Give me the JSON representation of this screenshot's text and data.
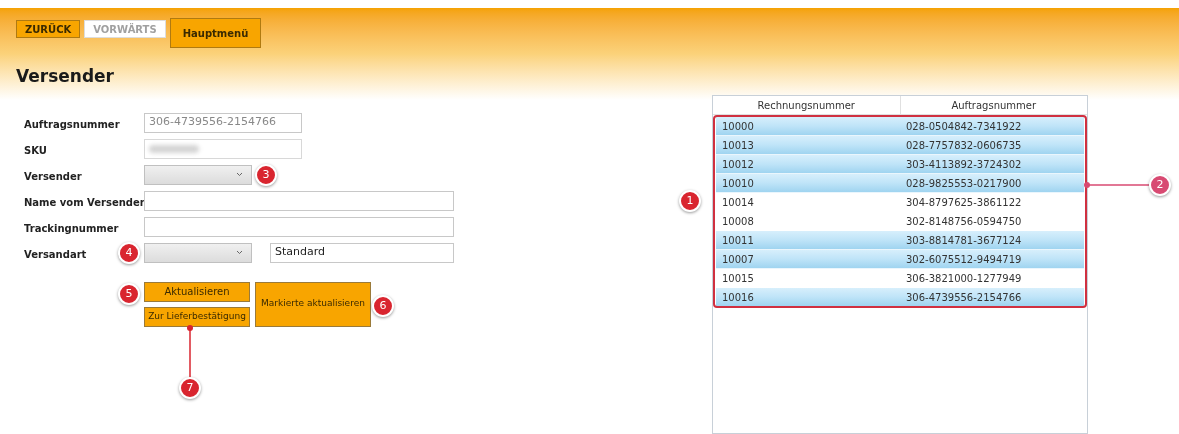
{
  "nav_buttons": [
    {
      "label": "ZURÜCK",
      "disabled": false,
      "selected": false
    },
    {
      "label": "VORWÄRTS",
      "disabled": true,
      "selected": false
    },
    {
      "label": "Hauptmenü",
      "disabled": false,
      "selected": true
    }
  ],
  "title": "Versender",
  "form": [
    {
      "kind": "text",
      "label": "Auftragsnummer",
      "value": "306-4739556-2154766",
      "readonly": true
    },
    {
      "kind": "blurred",
      "label": "SKU"
    },
    {
      "kind": "combo",
      "label": "Versender"
    },
    {
      "kind": "wide_text",
      "label": "Name vom Versender"
    },
    {
      "kind": "wide_text",
      "label": "Trackingnummer"
    },
    {
      "kind": "combo_text",
      "label": "Versandart",
      "value": "Standard"
    }
  ],
  "actions": {
    "update": "Aktualisieren",
    "confirm": "Zur Lieferbestätigung",
    "update_marked": "Markierte aktualisieren"
  },
  "table": {
    "columns": [
      "Rechnungsnummer",
      "Auftragsnummer"
    ],
    "rows": [
      {
        "cells": [
          "10000",
          "028-0504842-7341922"
        ],
        "selected": true
      },
      {
        "cells": [
          "10013",
          "028-7757832-0606735"
        ],
        "selected": true
      },
      {
        "cells": [
          "10012",
          "303-4113892-3724302"
        ],
        "selected": true
      },
      {
        "cells": [
          "10010",
          "028-9825553-0217900"
        ],
        "selected": true
      },
      {
        "cells": [
          "10014",
          "304-8797625-3861122"
        ],
        "selected": false
      },
      {
        "cells": [
          "10008",
          "302-8148756-0594750"
        ],
        "selected": false
      },
      {
        "cells": [
          "10011",
          "303-8814781-3677124"
        ],
        "selected": true
      },
      {
        "cells": [
          "10007",
          "302-6075512-9494719"
        ],
        "selected": true
      },
      {
        "cells": [
          "10015",
          "306-3821000-1277949"
        ],
        "selected": false
      },
      {
        "cells": [
          "10016",
          "306-4739556-2154766"
        ],
        "selected": true
      }
    ]
  },
  "callouts": [
    "1",
    "2",
    "3",
    "4",
    "5",
    "6",
    "7"
  ]
}
